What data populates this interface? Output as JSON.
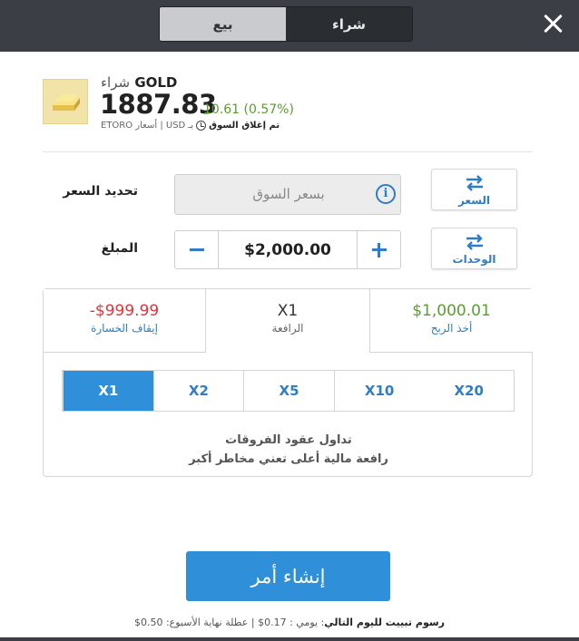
{
  "header": {
    "tab_buy": "شراء",
    "tab_sell": "بيع",
    "active_tab": "sell"
  },
  "instrument": {
    "name": "GOLD",
    "action": "شراء",
    "price": "1887.83",
    "change": "10.61 (0.57%)",
    "market_status": "تم إغلاق السوق",
    "source": "ETORO أسعار | USD بـ",
    "icon": "gold-bar-icon"
  },
  "price_setting": {
    "label": "تحديد السعر",
    "value": "بسعر السوق",
    "toggle_label": "السعر"
  },
  "amount": {
    "label": "المبلغ",
    "value": "$2,000.00",
    "toggle_label": "الوحدات"
  },
  "panel": {
    "take_profit": {
      "value": "$1,000.01",
      "label": "أخذ الربح"
    },
    "leverage": {
      "value": "X1",
      "label": "الرافعة"
    },
    "stop_loss": {
      "value": "-$999.99",
      "label": "إيقاف الخسارة"
    },
    "leverage_options": [
      "X20",
      "X10",
      "X5",
      "X2",
      "X1"
    ],
    "selected_leverage": "X1",
    "note_line1": "تداول عقود الفروقات",
    "note_line2": "رافعة مالية أعلى تعني مخاطر أكبر"
  },
  "submit_label": "إنشاء أمر",
  "fees": {
    "title": "رسوم تبييت لليوم التالي",
    "daily": "يومي : 0.17$",
    "weekend": "عطلة نهاية الأسبوع: 0.50$"
  },
  "colors": {
    "accent": "#2f8fd8",
    "positive": "#5a9e30",
    "negative": "#d9363e",
    "topbar": "#3b3f45"
  }
}
